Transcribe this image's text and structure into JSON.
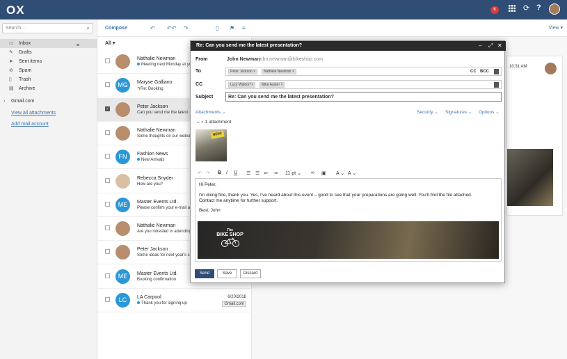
{
  "app": {
    "logo": "OX",
    "notification_count": "6",
    "view_label": "View ▾",
    "compose_label": "Compose"
  },
  "sidebar": {
    "search_placeholder": "Search...",
    "folders": [
      {
        "label": "Inbox",
        "icon": "inbox-icon"
      },
      {
        "label": "Drafts",
        "icon": "drafts-icon"
      },
      {
        "label": "Sent items",
        "icon": "sent-icon"
      },
      {
        "label": "Spam",
        "icon": "spam-icon"
      },
      {
        "label": "Trash",
        "icon": "trash-icon"
      },
      {
        "label": "Archive",
        "icon": "archive-icon"
      }
    ],
    "account": "Gmail.com",
    "view_all_attachments": "View all attachments",
    "add_mail_account": "Add mail account"
  },
  "list": {
    "filter": "All ▾",
    "messages": [
      {
        "name": "Nathalie Newman",
        "preview": "Meeting next Monday at your",
        "dot": true,
        "initials": ""
      },
      {
        "name": "Maryse Galliano",
        "preview": "↰Re: Booking",
        "dot": false,
        "initials": "MG"
      },
      {
        "name": "Peter Jackson",
        "preview": "Can you send me the latest",
        "dot": false,
        "initials": ""
      },
      {
        "name": "Nathalie Newman",
        "preview": "Some thoughts on our website",
        "dot": false,
        "initials": ""
      },
      {
        "name": "Fashion News",
        "preview": "New Arrivals",
        "dot": true,
        "initials": "FN"
      },
      {
        "name": "Rebecca Snyder",
        "preview": "How are you?",
        "dot": false,
        "initials": ""
      },
      {
        "name": "Master Events Ltd.",
        "preview": "Please confirm your e-mail addr",
        "dot": false,
        "initials": "ME"
      },
      {
        "name": "Nathalie Newman",
        "preview": "Are you intrested in attending th",
        "dot": false,
        "initials": ""
      },
      {
        "name": "Peter Jackson",
        "preview": "Some ideas for next year's seaso",
        "dot": false,
        "initials": ""
      },
      {
        "name": "Master Events Ltd.",
        "preview": "Booking confirmation",
        "dot": false,
        "initials": "ME"
      },
      {
        "name": "LA Carpool",
        "preview": "Thank you for signing up",
        "dot": true,
        "initials": "LC",
        "date": "6/20/2018",
        "tag": "Gmail.com"
      }
    ]
  },
  "reading": {
    "time": "10:31 AM"
  },
  "compose": {
    "title": "Re: Can you send me the latest presentation?",
    "from_label": "From",
    "from_name": "John Newman",
    "from_email": "john.newman@bikeshop.com",
    "to_label": "To",
    "to_recipients": [
      "Peter Jackson",
      "Nathalie Newman"
    ],
    "cc_label": "CC",
    "cc_recipients": [
      "Lucy Waldorf",
      "Mike Auster"
    ],
    "cc_toggle": "CC",
    "bcc_toggle": "BCC",
    "subject_label": "Subject",
    "subject": "Re: Can you send me the latest presentation?",
    "attachments_label": "Attachments",
    "security_label": "Security",
    "signatures_label": "Signatures",
    "options_label": "Options",
    "attachment_count": "1 attachment",
    "thumb_badge": "NEW!",
    "font_size": "11 pt",
    "body_greeting": "Hi Peter,",
    "body_line1": "I'm doing fine, thank you. Yes, I've heard about this event – good to see that your preparations are going well. You'll find the file attached.",
    "body_line2": "Contact me anytime for further support.",
    "body_signoff": "Best, John",
    "banner_title": "BIKE SHOP",
    "banner_sub": "The",
    "send": "Send",
    "save": "Save",
    "discard": "Discard"
  }
}
